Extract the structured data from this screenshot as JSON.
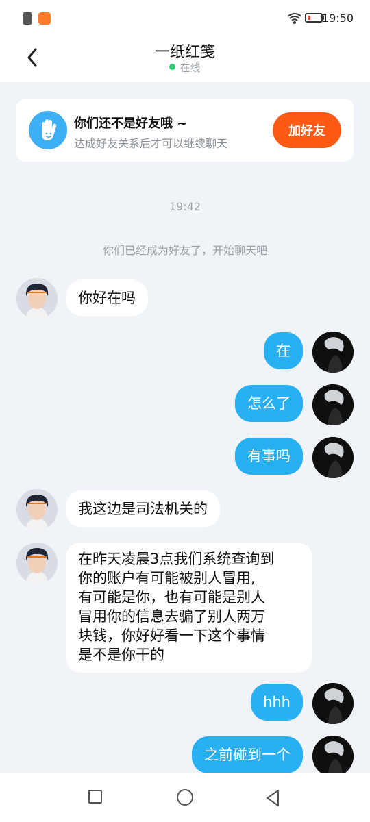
{
  "status_bar": {
    "time": "19:50"
  },
  "header": {
    "title": "一纸红笺",
    "status": "在线"
  },
  "friend_banner": {
    "title": "你们还不是好友哦 ~",
    "subtitle": "达成好友关系后才可以继续聊天",
    "button": "加好友"
  },
  "chat": {
    "timestamp": "19:42",
    "system_message": "你们已经成为好友了，开始聊天吧",
    "messages": [
      {
        "side": "left",
        "text": "你好在吗"
      },
      {
        "side": "right",
        "text": "在"
      },
      {
        "side": "right",
        "text": "怎么了"
      },
      {
        "side": "right",
        "text": "有事吗"
      },
      {
        "side": "left",
        "text": "我这边是司法机关的"
      },
      {
        "side": "left",
        "lines": [
          "在昨天凌晨3点我们系统查询到",
          "你的账户有可能被别人冒用,",
          "有可能是你，也有可能是别人",
          "冒用你的信息去骗了别人两万",
          "块钱，你好好看一下这个事情",
          "是不是你干的"
        ]
      },
      {
        "side": "right",
        "text": "hhh"
      },
      {
        "side": "right",
        "text": "之前碰到一个"
      }
    ]
  },
  "colors": {
    "accent": "#29b0f2",
    "add_button": "#ff5a14",
    "background": "#f0f3f7"
  }
}
